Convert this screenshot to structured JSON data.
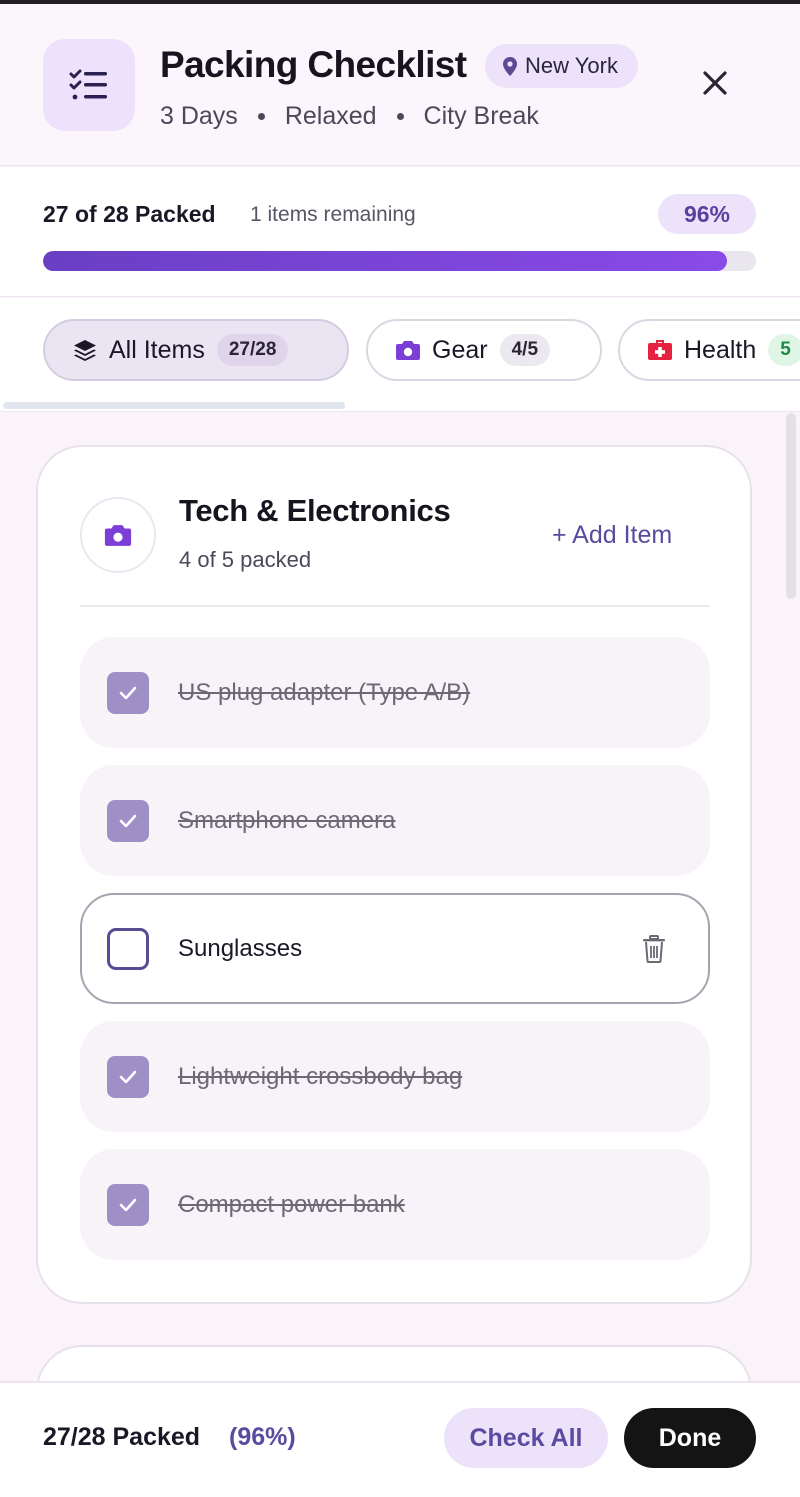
{
  "header": {
    "icon": "checklist-icon",
    "title": "Packing Checklist",
    "location": "New York",
    "location_icon": "map-pin-icon",
    "meta": [
      "3 Days",
      "Relaxed",
      "City Break"
    ],
    "close_icon": "close-icon"
  },
  "progress": {
    "packed_label": "27 of 28 Packed",
    "remaining_label": "1 items remaining",
    "percent_label": "96%",
    "fill_fraction": 0.96,
    "accent": "#7a46de"
  },
  "tabs": [
    {
      "icon": "layers-icon",
      "label": "All Items",
      "count": "27/28",
      "active": true
    },
    {
      "icon": "camera-icon",
      "label": "Gear",
      "count": "4/5",
      "active": false
    },
    {
      "icon": "first-aid-icon",
      "label": "Health",
      "count": "5",
      "active": false
    }
  ],
  "category": {
    "icon": "camera-icon",
    "title": "Tech & Electronics",
    "subtitle": "4 of 5 packed",
    "add_label": "+ Add Item",
    "items": [
      {
        "label": "US plug adapter (Type A/B)",
        "packed": true
      },
      {
        "label": "Smartphone camera",
        "packed": true
      },
      {
        "label": "Sunglasses",
        "packed": false
      },
      {
        "label": "Lightweight crossbody bag",
        "packed": true
      },
      {
        "label": "Compact power bank",
        "packed": true
      }
    ]
  },
  "footer": {
    "packed_label": "27/28 Packed",
    "percent_label": "(96%)",
    "check_all_label": "Check All",
    "done_label": "Done"
  },
  "colors": {
    "brand_purple": "#5a4ba0",
    "checked_box": "#9e8fc7",
    "health_red": "#e5223f",
    "gear_purple": "#7b3fd6"
  }
}
